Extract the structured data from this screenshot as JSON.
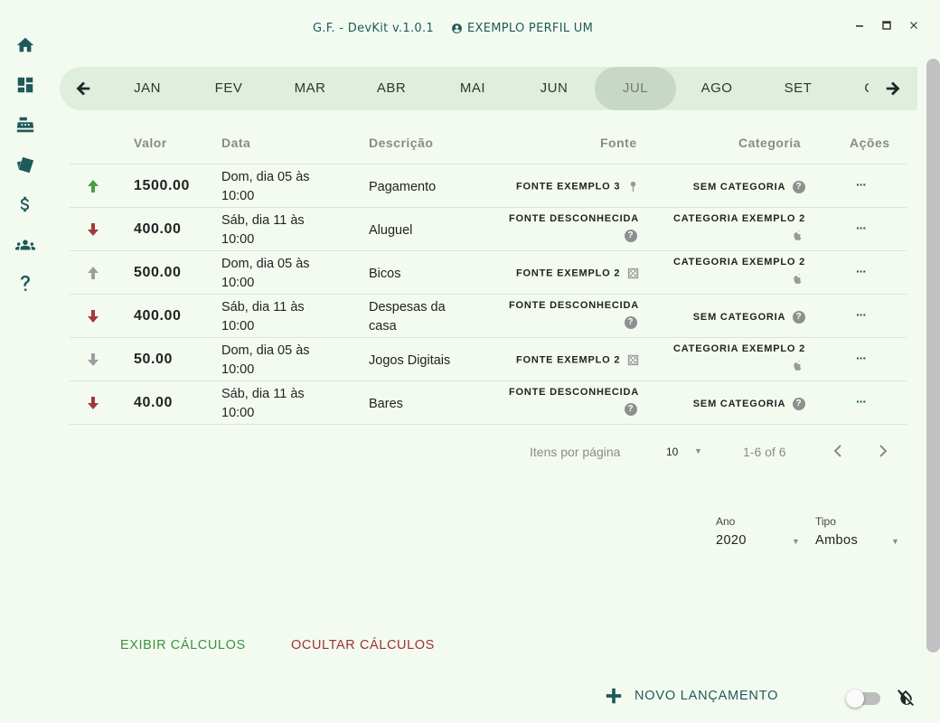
{
  "titlebar": {
    "app_title": "G.F. - DevKit v.1.0.1",
    "profile_name": "EXEMPLO PERFIL UM",
    "minimize": "–",
    "maximize": "□",
    "close": "×"
  },
  "sidebar": {
    "items": [
      {
        "icon": "home-icon"
      },
      {
        "icon": "dashboard-icon"
      },
      {
        "icon": "cash-register-icon"
      },
      {
        "icon": "cards-icon"
      },
      {
        "icon": "dollar-icon"
      },
      {
        "icon": "people-icon"
      },
      {
        "icon": "help-icon"
      }
    ]
  },
  "months": {
    "labels": [
      "JAN",
      "FEV",
      "MAR",
      "ABR",
      "MAI",
      "JUN",
      "JUL",
      "AGO",
      "SET",
      "OUT"
    ],
    "active": "JUL"
  },
  "table": {
    "headers": {
      "valor": "Valor",
      "data": "Data",
      "descricao": "Descrição",
      "fonte": "Fonte",
      "categoria": "Categoria",
      "acoes": "Ações"
    },
    "rows": [
      {
        "direction": "up",
        "status_color": "#4a9e4a",
        "valor": "1500.00",
        "data_l1": "Dom, dia 05 às",
        "data_l2": "10:00",
        "descricao_l1": "Pagamento",
        "descricao_l2": "",
        "fonte": "FONTE EXEMPLO 3",
        "fonte_icon": "pin-icon",
        "categoria": "SEM CATEGORIA",
        "categoria_icon": "question-icon",
        "acoes": "···"
      },
      {
        "direction": "down",
        "status_color": "#a33a3a",
        "valor": "400.00",
        "data_l1": "Sáb, dia 11 às",
        "data_l2": "10:00",
        "descricao_l1": "Aluguel",
        "descricao_l2": "",
        "fonte": "FONTE DESCONHECIDA",
        "fonte_icon": "question-icon",
        "categoria": "CATEGORIA EXEMPLO 2",
        "categoria_icon": "apple-icon",
        "acoes": "···"
      },
      {
        "direction": "up",
        "status_color": "#9e9e9e",
        "valor": "500.00",
        "data_l1": "Dom, dia 05 às",
        "data_l2": "10:00",
        "descricao_l1": "Bicos",
        "descricao_l2": "",
        "fonte": "FONTE EXEMPLO 2",
        "fonte_icon": "crosshatch-icon",
        "categoria": "CATEGORIA EXEMPLO 2",
        "categoria_icon": "apple-icon",
        "acoes": "···"
      },
      {
        "direction": "down",
        "status_color": "#a33a3a",
        "valor": "400.00",
        "data_l1": "Sáb, dia 11 às",
        "data_l2": "10:00",
        "descricao_l1": "Despesas da",
        "descricao_l2": "casa",
        "fonte": "FONTE DESCONHECIDA",
        "fonte_icon": "question-icon",
        "categoria": "SEM CATEGORIA",
        "categoria_icon": "question-icon",
        "acoes": "···"
      },
      {
        "direction": "down",
        "status_color": "#9e9e9e",
        "valor": "50.00",
        "data_l1": "Dom, dia 05 às",
        "data_l2": "10:00",
        "descricao_l1": "Jogos Digitais",
        "descricao_l2": "",
        "fonte": "FONTE EXEMPLO 2",
        "fonte_icon": "crosshatch-icon",
        "categoria": "CATEGORIA EXEMPLO 2",
        "categoria_icon": "apple-icon",
        "acoes": "···"
      },
      {
        "direction": "down",
        "status_color": "#a33a3a",
        "valor": "40.00",
        "data_l1": "Sáb, dia 11 às",
        "data_l2": "10:00",
        "descricao_l1": "Bares",
        "descricao_l2": "",
        "fonte": "FONTE DESCONHECIDA",
        "fonte_icon": "question-icon",
        "categoria": "SEM CATEGORIA",
        "categoria_icon": "question-icon",
        "acoes": "···"
      }
    ]
  },
  "paginator": {
    "label": "Itens por página",
    "page_size": "10",
    "range": "1-6 of 6"
  },
  "filters": {
    "ano_label": "Ano",
    "ano_value": "2020",
    "tipo_label": "Tipo",
    "tipo_value": "Ambos"
  },
  "actions": {
    "exibir": "EXIBIR CÁLCULOS",
    "ocultar": "OCULTAR CÁLCULOS",
    "novo": "NOVO LANÇAMENTO"
  },
  "colors": {
    "brand": "#1f5a5a",
    "background": "#f3fbf1",
    "month_bar": "#dfeedd",
    "month_active": "#c7d9c6",
    "exibir": "#3f8f3f",
    "ocultar": "#a33030"
  }
}
